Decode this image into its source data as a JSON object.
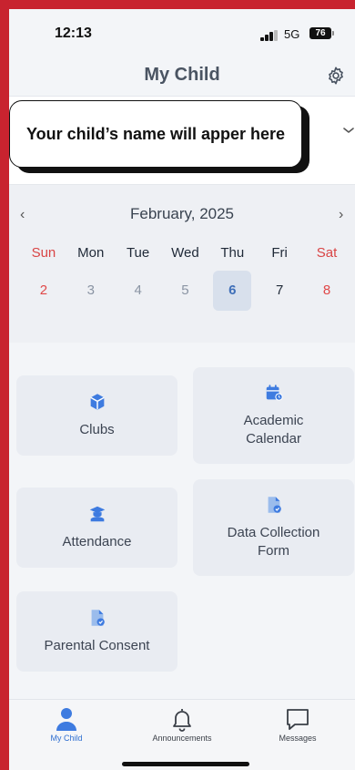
{
  "status_bar": {
    "time": "12:13",
    "network": "5G",
    "battery": "76"
  },
  "header": {
    "title": "My Child",
    "settings_icon": "gear-icon"
  },
  "child_selector": {
    "placeholder_text": "Your child’s name will apper here",
    "dropdown_icon": "chevron-down-icon"
  },
  "calendar": {
    "month_label": "February, 2025",
    "prev_icon": "‹",
    "next_icon": "›",
    "weekdays": [
      "Sun",
      "Mon",
      "Tue",
      "Wed",
      "Thu",
      "Fri",
      "Sat"
    ],
    "days": [
      "2",
      "3",
      "4",
      "5",
      "6",
      "7",
      "8"
    ],
    "selected_day": "6"
  },
  "tiles": [
    {
      "label": "Clubs",
      "icon": "cube-icon"
    },
    {
      "label": "Academic Calendar",
      "icon": "calendar-clock-icon"
    },
    {
      "label": "Attendance",
      "icon": "graduation-cap-icon"
    },
    {
      "label": "Data Collection Form",
      "icon": "document-check-icon"
    },
    {
      "label": "Parental Consent",
      "icon": "document-check-icon"
    }
  ],
  "bottom_nav": [
    {
      "label": "My Child",
      "icon": "person-icon",
      "active": true
    },
    {
      "label": "Announcements",
      "icon": "bell-icon",
      "active": false
    },
    {
      "label": "Messages",
      "icon": "chat-bubble-icon",
      "active": false
    }
  ],
  "colors": {
    "frame": "#c8232f",
    "accent": "#2f6fd0",
    "weekend": "#e04848",
    "tile_bg": "#e9ecf2"
  }
}
